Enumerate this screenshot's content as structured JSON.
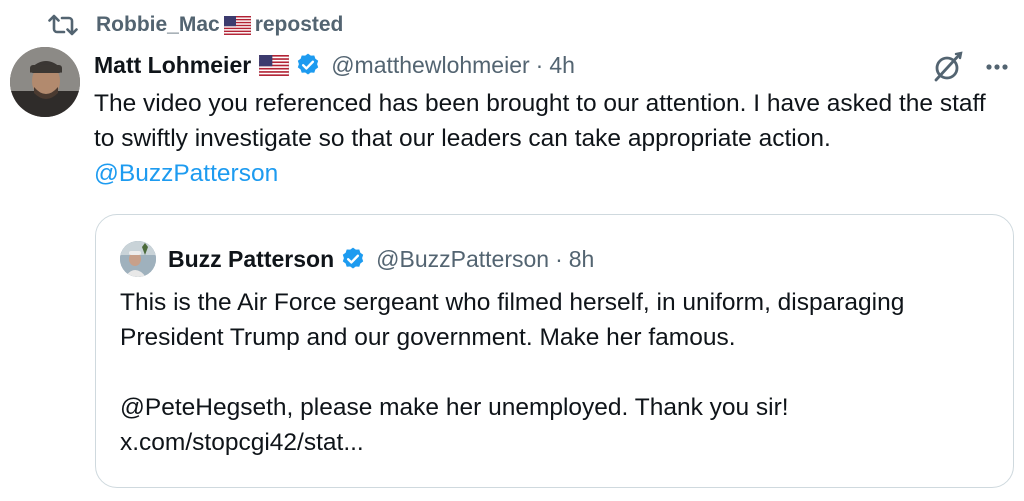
{
  "repost": {
    "user": "Robbie_Mac",
    "label": "reposted"
  },
  "tweet": {
    "author_name": "Matt Lohmeier",
    "handle": "@matthewlohmeier",
    "separator": "·",
    "time": "4h",
    "text_before": "The video you referenced has been brought to our attention. I have asked the staff to swiftly investigate so that our leaders can take appropriate action. ",
    "mention": "@BuzzPatterson"
  },
  "quote": {
    "author_name": "Buzz Patterson",
    "handle": "@BuzzPatterson",
    "separator": "·",
    "time": "8h",
    "paragraph_1": "This is the Air Force sergeant who filmed herself, in uniform, disparaging President Trump and our government. Make her famous.",
    "paragraph_2": "@PeteHegseth, please make her unemployed. Thank you sir!",
    "link": "x.com/stopcgi42/stat..."
  },
  "icons": {
    "repost": "repost-icon",
    "flag": "us-flag-icon",
    "verified": "verified-badge-icon",
    "grok": "grok-icon",
    "more": "more-options-icon"
  },
  "colors": {
    "text": "#0f1419",
    "muted": "#536471",
    "link": "#1d9bf0",
    "verified": "#1d9bf0",
    "border": "#cfd9de"
  }
}
